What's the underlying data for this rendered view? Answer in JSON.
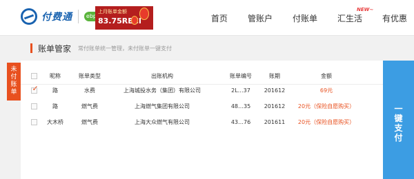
{
  "header": {
    "logo_text": "付费通",
    "logo_badge": "ebpp",
    "banner": {
      "top_text": "上月账单金额",
      "amount_text": "83.75RECI"
    },
    "nav": [
      {
        "label": "首页"
      },
      {
        "label": "管账户"
      },
      {
        "label": "付账单"
      },
      {
        "label": "汇生活",
        "badge": "NEW~"
      },
      {
        "label": "有优惠"
      }
    ]
  },
  "section": {
    "title": "账单管家",
    "description": "常付账单统一管理，未付账单一键支付"
  },
  "left_tab": {
    "chars": [
      "未",
      "付",
      "账",
      "单"
    ]
  },
  "table": {
    "headers": [
      "昵称",
      "账单类型",
      "出账机构",
      "账单编号",
      "账期",
      "金额"
    ],
    "rows": [
      {
        "checked": true,
        "nickname": "路",
        "type": "水费",
        "org": "上海城投水务（集团）有限公司",
        "bill_no": "2L…37",
        "period": "201612",
        "amount": "69元",
        "red": true
      },
      {
        "checked": false,
        "nickname": "路",
        "type": "燃气费",
        "org": "上海燃气集团有限公司",
        "bill_no": "48…35",
        "period": "201612",
        "amount": "20元（保险自愿购买）",
        "red": true
      },
      {
        "checked": false,
        "nickname": "大木桥",
        "type": "燃气费",
        "org": "上海大众燃气有限公司",
        "bill_no": "43…76",
        "period": "201611",
        "amount": "20元（保险自愿购买）",
        "red": true
      }
    ]
  },
  "pay_button": {
    "chars": [
      "一",
      "键",
      "支",
      "付"
    ]
  },
  "colors": {
    "accent_orange": "#e8501f",
    "brand_blue": "#1a63b0",
    "pay_blue": "#3c9de3"
  }
}
